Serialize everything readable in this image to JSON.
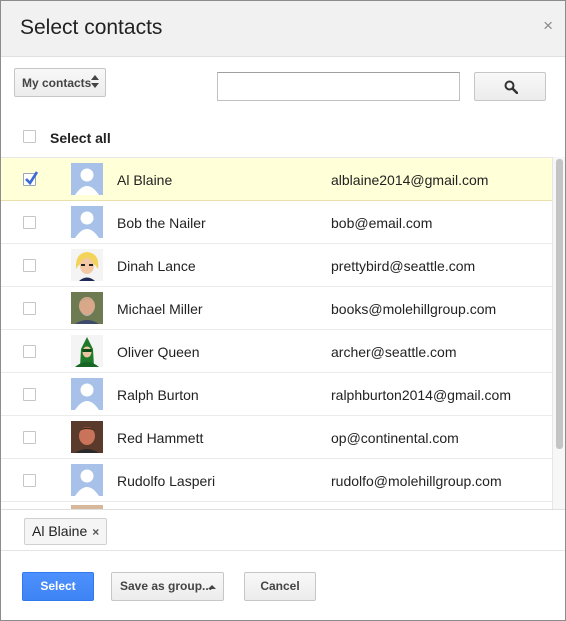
{
  "dialog": {
    "title": "Select contacts",
    "close_glyph": "×"
  },
  "toolbar": {
    "group_select_label": "My contacts",
    "search_value": "",
    "search_icon": "search-icon"
  },
  "select_all": {
    "label": "Select all",
    "checked": false
  },
  "contacts": [
    {
      "name": "Al Blaine",
      "email": "alblaine2014@gmail.com",
      "checked": true,
      "avatar": "default-avatar-icon"
    },
    {
      "name": "Bob the Nailer",
      "email": "bob@email.com",
      "checked": false,
      "avatar": "default-avatar-icon"
    },
    {
      "name": "Dinah Lance",
      "email": "prettybird@seattle.com",
      "checked": false,
      "avatar": "photo-avatar"
    },
    {
      "name": "Michael Miller",
      "email": "books@molehillgroup.com",
      "checked": false,
      "avatar": "photo-avatar"
    },
    {
      "name": "Oliver Queen",
      "email": "archer@seattle.com",
      "checked": false,
      "avatar": "photo-avatar"
    },
    {
      "name": "Ralph Burton",
      "email": "ralphburton2014@gmail.com",
      "checked": false,
      "avatar": "default-avatar-icon"
    },
    {
      "name": "Red Hammett",
      "email": "op@continental.com",
      "checked": false,
      "avatar": "photo-avatar"
    },
    {
      "name": "Rudolfo Lasperi",
      "email": "rudolfo@molehillgroup.com",
      "checked": false,
      "avatar": "default-avatar-icon"
    }
  ],
  "selected_chips": [
    {
      "label": "Al Blaine",
      "remove_glyph": "×"
    }
  ],
  "footer": {
    "select_label": "Select",
    "save_group_label": "Save as group...",
    "cancel_label": "Cancel"
  },
  "colors": {
    "primary_button": "#4d90fe",
    "selected_row": "#ffffd8",
    "check_mark": "#3b6bd6",
    "default_avatar_bg": "#a7c1e8"
  }
}
